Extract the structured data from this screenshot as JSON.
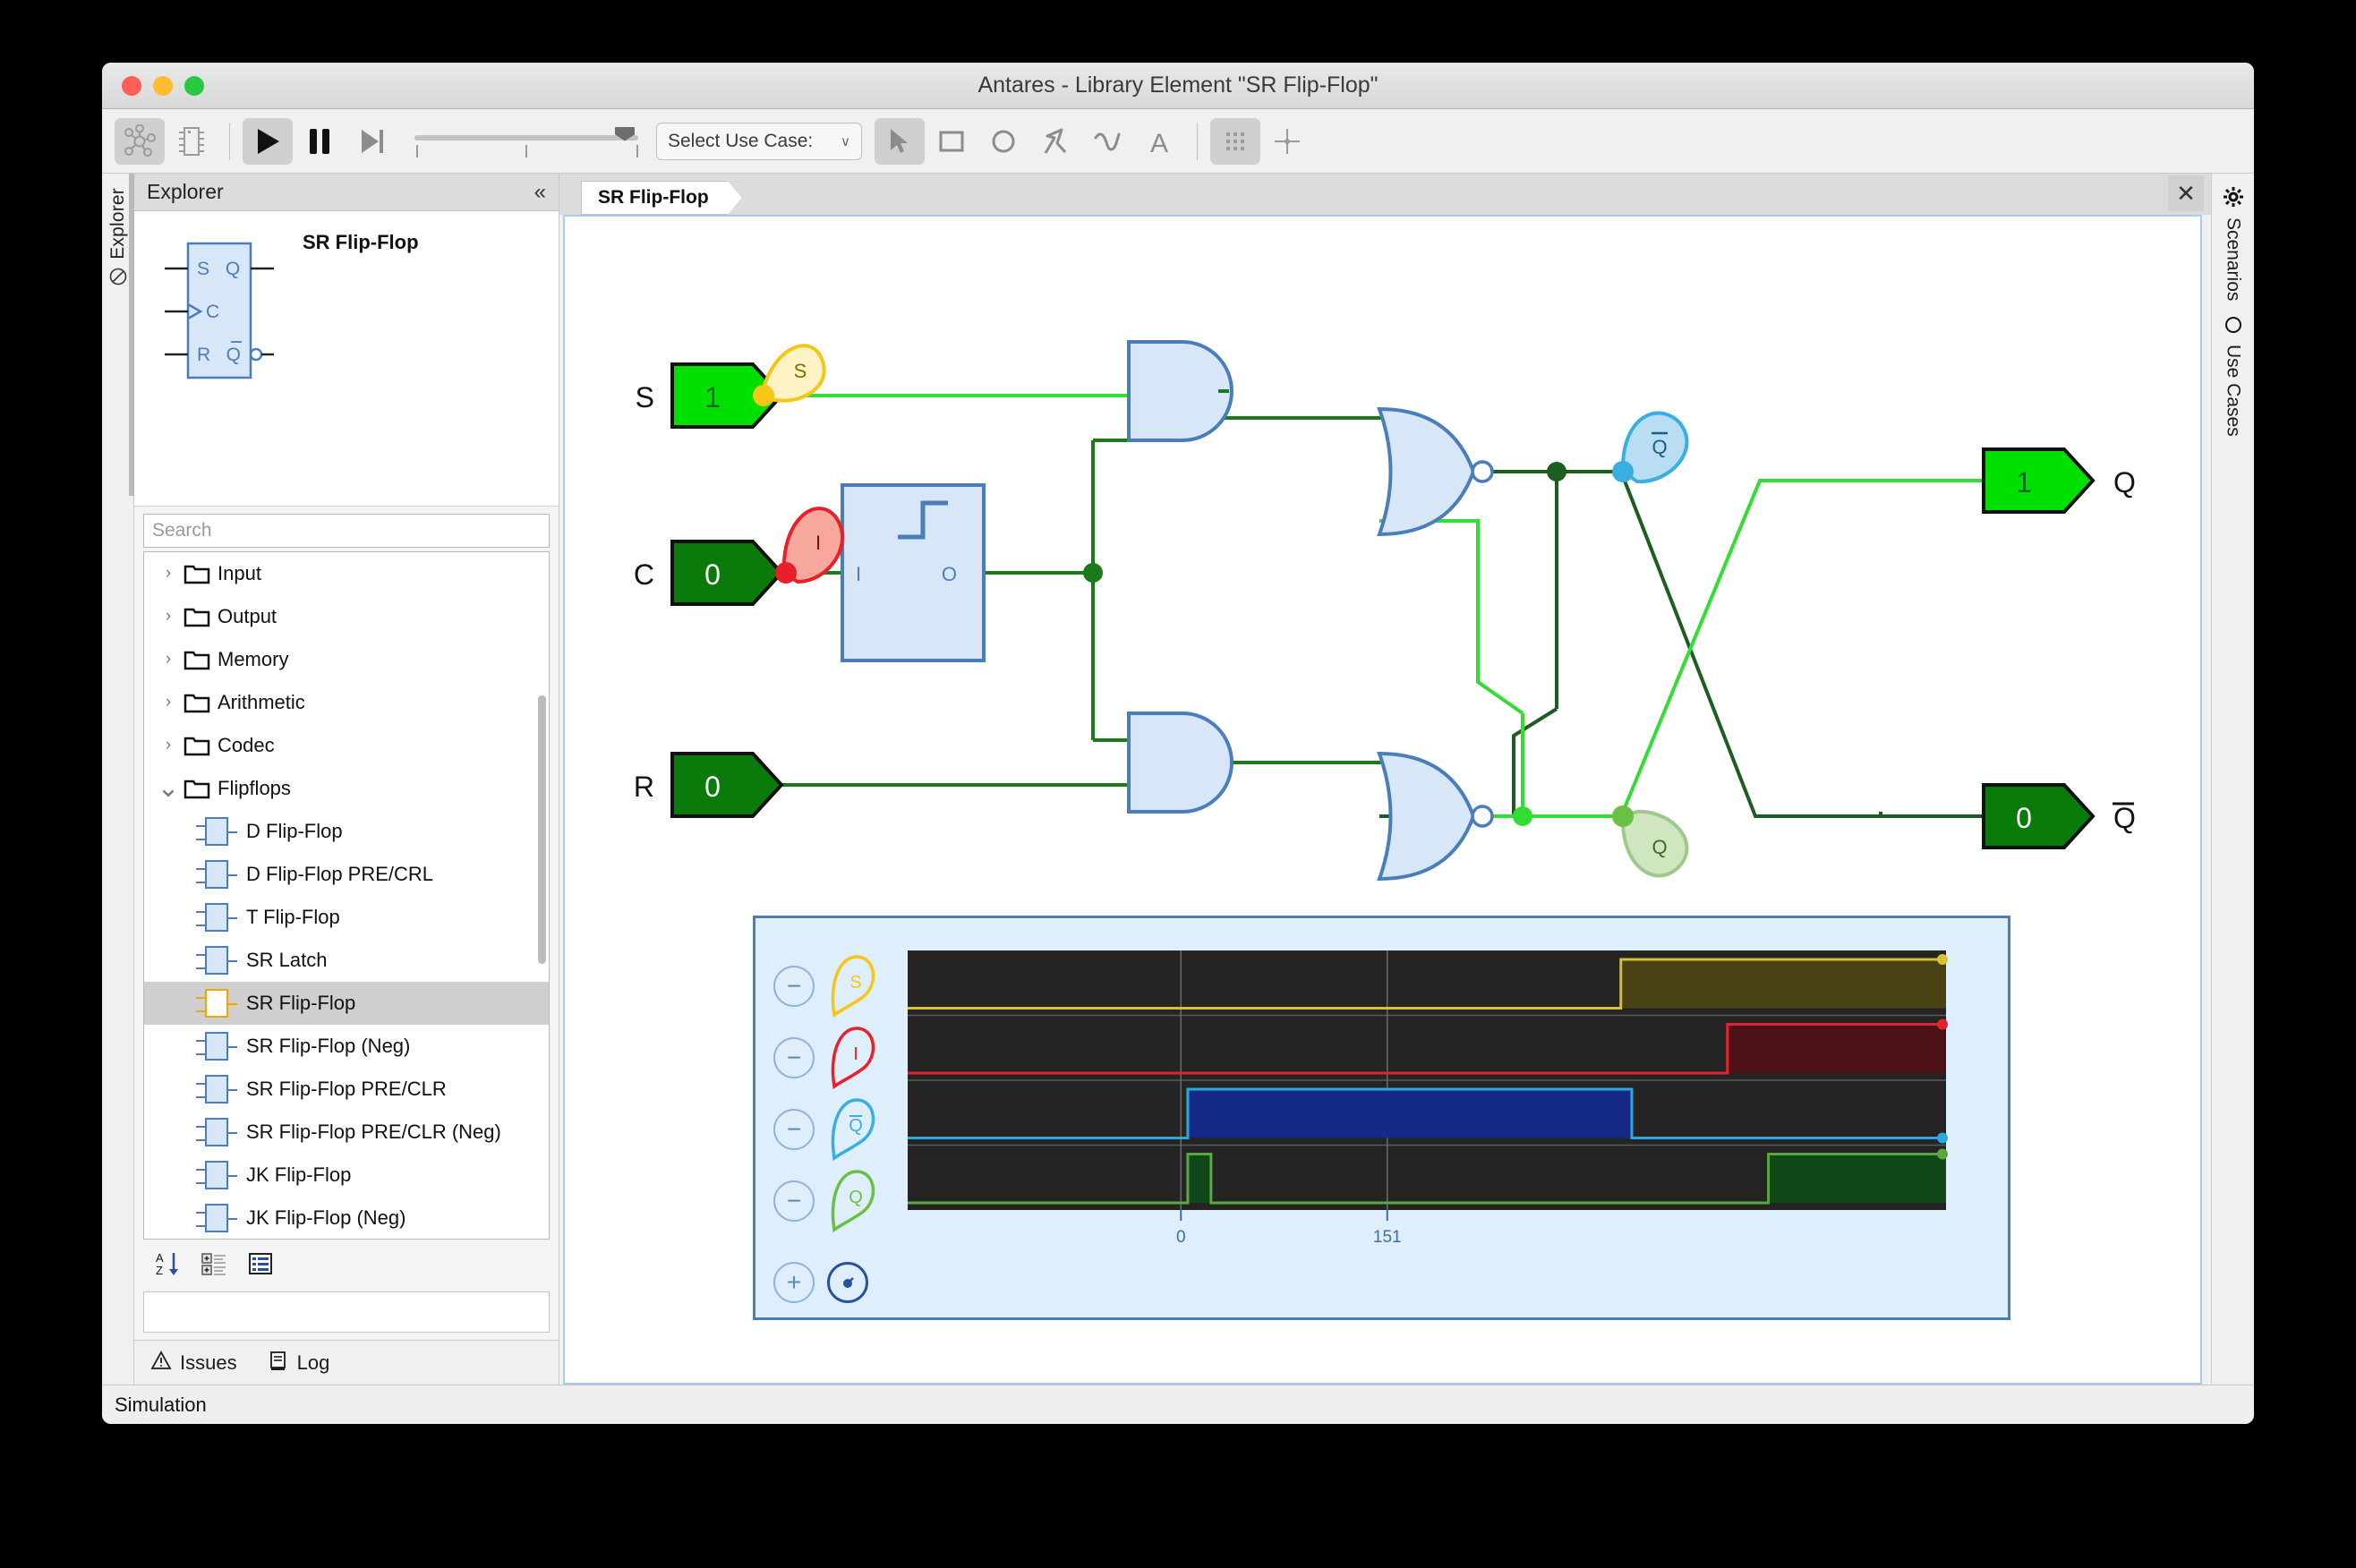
{
  "window": {
    "title": "Antares - Library Element \"SR Flip-Flop\"",
    "traffic": [
      "close",
      "minimize",
      "zoom"
    ]
  },
  "toolbar": {
    "buttons": [
      {
        "name": "network-view",
        "icon": "network-icon",
        "active": true
      },
      {
        "name": "chip-view",
        "icon": "chip-icon",
        "active": false
      },
      {
        "name": "run",
        "icon": "play-icon",
        "active": true
      },
      {
        "name": "pause",
        "icon": "pause-icon",
        "active": false
      },
      {
        "name": "step",
        "icon": "step-forward-icon",
        "active": false
      }
    ],
    "speed_slider": {
      "value": 78,
      "ticks": [
        0,
        50,
        100
      ]
    },
    "use_case_select": {
      "label": "Select Use Case:",
      "chevron": "∨"
    },
    "tools": [
      {
        "name": "select",
        "icon": "cursor-icon",
        "active": true
      },
      {
        "name": "rectangle",
        "icon": "rectangle-icon",
        "active": false
      },
      {
        "name": "ellipse",
        "icon": "ellipse-icon",
        "active": false
      },
      {
        "name": "polyline",
        "icon": "polyline-icon",
        "active": false
      },
      {
        "name": "curve",
        "icon": "curve-icon",
        "active": false
      },
      {
        "name": "text",
        "icon": "text-icon",
        "active": false
      }
    ],
    "grid_button": {
      "icon": "grid-icon",
      "active": true
    },
    "origin_button": {
      "icon": "crosshair-icon",
      "active": false
    }
  },
  "left_rail": {
    "label": "Explorer",
    "icon": "no-entry-icon"
  },
  "explorer": {
    "header": "Explorer",
    "collapse": "«",
    "preview": {
      "name": "SR Flip-Flop",
      "inputs": [
        "S",
        "C",
        "R"
      ],
      "outputs": [
        "Q",
        "Q̄"
      ]
    },
    "search": {
      "placeholder": "Search",
      "value": ""
    },
    "tree": [
      {
        "label": "Input",
        "type": "folder",
        "expanded": false,
        "indent": 0
      },
      {
        "label": "Output",
        "type": "folder",
        "expanded": false,
        "indent": 0
      },
      {
        "label": "Memory",
        "type": "folder",
        "expanded": false,
        "indent": 0
      },
      {
        "label": "Arithmetic",
        "type": "folder",
        "expanded": false,
        "indent": 0
      },
      {
        "label": "Codec",
        "type": "folder",
        "expanded": false,
        "indent": 0
      },
      {
        "label": "Flipflops",
        "type": "folder",
        "expanded": true,
        "indent": 0
      },
      {
        "label": "D Flip-Flop",
        "type": "element",
        "indent": 1,
        "selected": false
      },
      {
        "label": "D Flip-Flop PRE/CRL",
        "type": "element",
        "indent": 1,
        "selected": false
      },
      {
        "label": "T Flip-Flop",
        "type": "element",
        "indent": 1,
        "selected": false
      },
      {
        "label": "SR Latch",
        "type": "element",
        "indent": 1,
        "selected": false
      },
      {
        "label": "SR Flip-Flop",
        "type": "element",
        "indent": 1,
        "selected": true
      },
      {
        "label": "SR Flip-Flop (Neg)",
        "type": "element",
        "indent": 1,
        "selected": false
      },
      {
        "label": "SR Flip-Flop PRE/CLR",
        "type": "element",
        "indent": 1,
        "selected": false
      },
      {
        "label": "SR Flip-Flop PRE/CLR (Neg)",
        "type": "element",
        "indent": 1,
        "selected": false
      },
      {
        "label": "JK Flip-Flop",
        "type": "element",
        "indent": 1,
        "selected": false
      },
      {
        "label": "JK Flip-Flop (Neg)",
        "type": "element",
        "indent": 1,
        "selected": false
      }
    ],
    "tree_toolbar": [
      {
        "name": "sort-alpha",
        "icon": "sort-az-icon"
      },
      {
        "name": "expand-all",
        "icon": "expand-tree-icon"
      },
      {
        "name": "list-view",
        "icon": "list-icon"
      }
    ],
    "name_field": {
      "value": ""
    },
    "bottom_tabs": [
      {
        "label": "Issues",
        "icon": "warning-icon"
      },
      {
        "label": "Log",
        "icon": "log-icon"
      }
    ]
  },
  "editor": {
    "tab": {
      "label": "SR Flip-Flop"
    },
    "close": "✕"
  },
  "right_rail": [
    {
      "label": "Scenarios",
      "icon": "gear-icon"
    },
    {
      "label": "Use Cases",
      "icon": "circle-icon"
    }
  ],
  "statusbar": {
    "text": "Simulation"
  },
  "circuit": {
    "inputs": [
      {
        "label": "S",
        "value": "1",
        "state": "high"
      },
      {
        "label": "C",
        "value": "0",
        "state": "low"
      },
      {
        "label": "R",
        "value": "0",
        "state": "low"
      }
    ],
    "outputs": [
      {
        "label": "Q",
        "value": "1",
        "state": "high"
      },
      {
        "label": "Q̄",
        "value": "0",
        "state": "low"
      }
    ],
    "gates": [
      {
        "type": "and",
        "name": "and-gate-top"
      },
      {
        "type": "and",
        "name": "and-gate-bottom"
      },
      {
        "type": "nor",
        "name": "nor-gate-top"
      },
      {
        "type": "nor",
        "name": "nor-gate-bottom"
      },
      {
        "type": "edge-detector",
        "name": "edge-detector",
        "pin_in": "I",
        "pin_out": "O"
      }
    ],
    "probes": [
      {
        "label": "S",
        "color": "#f5c518",
        "fill": "#fdf3c4"
      },
      {
        "label": "I",
        "color": "#e8202a",
        "fill": "#f7a79d"
      },
      {
        "label": "Q̄",
        "color": "#3aaee0",
        "fill": "#b9ddf2"
      },
      {
        "label": "Q",
        "color": "#6cbf45",
        "fill": "#cfe6c1"
      }
    ]
  },
  "chart_data": {
    "type": "line",
    "title": "Simulation waveforms",
    "xlabel": "",
    "ylabel": "",
    "grid": true,
    "x_ticks": [
      0,
      151
    ],
    "x_tick_labels": [
      "0",
      "151"
    ],
    "xlim": [
      -200,
      560
    ],
    "series": [
      {
        "name": "S",
        "color": "#d8c132",
        "fill": "#4a4215",
        "points": [
          [
            -200,
            0
          ],
          [
            0,
            0
          ],
          [
            322,
            0
          ],
          [
            322,
            1
          ],
          [
            560,
            1
          ]
        ]
      },
      {
        "name": "I",
        "color": "#e02430",
        "fill": "#4d1215",
        "points": [
          [
            -200,
            0
          ],
          [
            0,
            0
          ],
          [
            400,
            0
          ],
          [
            400,
            1
          ],
          [
            560,
            1
          ]
        ]
      },
      {
        "name": "Q̄",
        "color": "#29a8dd",
        "fill": "#152a86",
        "points": [
          [
            -200,
            0
          ],
          [
            5,
            0
          ],
          [
            5,
            1
          ],
          [
            330,
            1
          ],
          [
            330,
            0
          ],
          [
            560,
            0
          ]
        ]
      },
      {
        "name": "Q",
        "color": "#59a93f",
        "fill": "#12471a",
        "points": [
          [
            -200,
            0
          ],
          [
            5,
            0
          ],
          [
            5,
            1
          ],
          [
            22,
            1
          ],
          [
            22,
            0
          ],
          [
            430,
            0
          ],
          [
            430,
            1
          ],
          [
            560,
            1
          ]
        ]
      }
    ],
    "legend_position": "left",
    "background": "#242424"
  },
  "wave_controls": {
    "minus": "−",
    "plus": "+",
    "clock": "clock-icon"
  }
}
